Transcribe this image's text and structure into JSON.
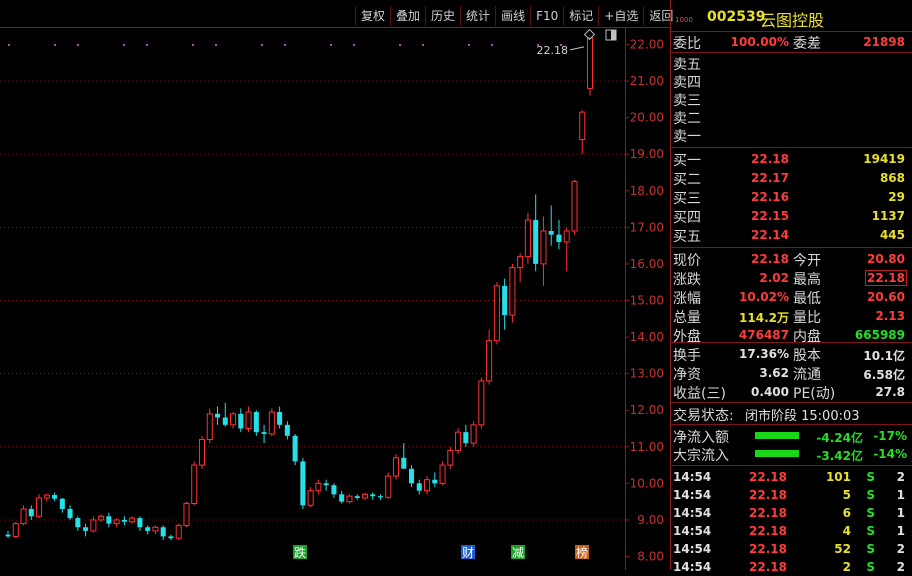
{
  "toolbar": [
    "复权",
    "叠加",
    "历史",
    "统计",
    "画线",
    "F10",
    "标记",
    "+自选",
    "返回"
  ],
  "stock": {
    "code_small": "1000",
    "code": "002539",
    "name": "云图控股"
  },
  "ratio": {
    "label": "委比",
    "value": "100.00%",
    "diff_label": "委差",
    "diff": "21898"
  },
  "sells": [
    {
      "label": "卖五",
      "price": "",
      "vol": ""
    },
    {
      "label": "卖四",
      "price": "",
      "vol": ""
    },
    {
      "label": "卖三",
      "price": "",
      "vol": ""
    },
    {
      "label": "卖二",
      "price": "",
      "vol": ""
    },
    {
      "label": "卖一",
      "price": "",
      "vol": ""
    }
  ],
  "buys": [
    {
      "label": "买一",
      "price": "22.18",
      "vol": "19419"
    },
    {
      "label": "买二",
      "price": "22.17",
      "vol": "868"
    },
    {
      "label": "买三",
      "price": "22.16",
      "vol": "29"
    },
    {
      "label": "买四",
      "price": "22.15",
      "vol": "1137"
    },
    {
      "label": "买五",
      "price": "22.14",
      "vol": "445"
    }
  ],
  "quote": [
    {
      "l1": "现价",
      "v1": "22.18",
      "c1": "red",
      "l2": "今开",
      "v2": "20.80",
      "c2": "red"
    },
    {
      "l1": "涨跌",
      "v1": "2.02",
      "c1": "red",
      "l2": "最高",
      "v2": "22.18",
      "c2": "red"
    },
    {
      "l1": "涨幅",
      "v1": "10.02%",
      "c1": "red",
      "l2": "最低",
      "v2": "20.60",
      "c2": "red"
    },
    {
      "l1": "总量",
      "v1": "114.2万",
      "c1": "yel",
      "l2": "量比",
      "v2": "2.13",
      "c2": "red"
    },
    {
      "l1": "外盘",
      "v1": "476487",
      "c1": "red",
      "l2": "内盘",
      "v2": "665989",
      "c2": "grn"
    }
  ],
  "fund": [
    {
      "l1": "换手",
      "v1": "17.36%",
      "l2": "股本",
      "v2": "10.1亿"
    },
    {
      "l1": "净资",
      "v1": "3.62",
      "l2": "流通",
      "v2": "6.58亿"
    },
    {
      "l1": "收益(三)",
      "v1": "0.400",
      "l2": "PE(动)",
      "v2": "27.8"
    }
  ],
  "status": {
    "label": "交易状态:",
    "value": "闭市阶段 15:00:03"
  },
  "flows": [
    {
      "label": "净流入额",
      "value": "-4.24亿",
      "pct": "-17%"
    },
    {
      "label": "大宗流入",
      "value": "-3.42亿",
      "pct": "-14%"
    }
  ],
  "ticks": [
    {
      "time": "14:54",
      "price": "22.18",
      "vol": "101",
      "bs": "S",
      "n": "2"
    },
    {
      "time": "14:54",
      "price": "22.18",
      "vol": "5",
      "bs": "S",
      "n": "1"
    },
    {
      "time": "14:54",
      "price": "22.18",
      "vol": "6",
      "bs": "S",
      "n": "1"
    },
    {
      "time": "14:54",
      "price": "22.18",
      "vol": "4",
      "bs": "S",
      "n": "1"
    },
    {
      "time": "14:54",
      "price": "22.18",
      "vol": "52",
      "bs": "S",
      "n": "2"
    },
    {
      "time": "14:54",
      "price": "22.18",
      "vol": "2",
      "bs": "S",
      "n": "2"
    }
  ],
  "chart_data": {
    "type": "candlestick",
    "price_label": "22.18",
    "y_ticks": [
      "22.00",
      "21.00",
      "20.00",
      "19.00",
      "18.00",
      "17.00",
      "16.00",
      "15.00",
      "14.00",
      "13.00",
      "12.00",
      "11.00",
      "10.00",
      "9.00",
      "8.00"
    ],
    "ylim": [
      7.85,
      22.45
    ],
    "markers": [
      "跌",
      "财",
      "减",
      "榜"
    ],
    "candles": [
      [
        8.6,
        8.7,
        8.5,
        8.55
      ],
      [
        8.55,
        8.95,
        8.5,
        8.9
      ],
      [
        8.9,
        9.4,
        8.85,
        9.3
      ],
      [
        9.3,
        9.4,
        9.0,
        9.1
      ],
      [
        9.1,
        9.7,
        9.05,
        9.6
      ],
      [
        9.6,
        9.72,
        9.5,
        9.68
      ],
      [
        9.68,
        9.75,
        9.52,
        9.58
      ],
      [
        9.58,
        9.6,
        9.2,
        9.3
      ],
      [
        9.3,
        9.4,
        9.0,
        9.05
      ],
      [
        9.05,
        9.1,
        8.7,
        8.8
      ],
      [
        8.8,
        8.9,
        8.55,
        8.7
      ],
      [
        8.7,
        9.1,
        8.65,
        9.0
      ],
      [
        9.0,
        9.15,
        8.95,
        9.1
      ],
      [
        9.1,
        9.2,
        8.8,
        8.9
      ],
      [
        8.9,
        9.05,
        8.8,
        9.0
      ],
      [
        9.0,
        9.1,
        8.85,
        8.95
      ],
      [
        8.95,
        9.1,
        8.9,
        9.05
      ],
      [
        9.05,
        9.1,
        8.7,
        8.8
      ],
      [
        8.8,
        8.85,
        8.6,
        8.7
      ],
      [
        8.7,
        8.85,
        8.6,
        8.8
      ],
      [
        8.8,
        8.85,
        8.45,
        8.55
      ],
      [
        8.55,
        8.6,
        8.45,
        8.5
      ],
      [
        8.5,
        8.9,
        8.45,
        8.85
      ],
      [
        8.85,
        9.5,
        8.8,
        9.45
      ],
      [
        9.45,
        10.6,
        9.4,
        10.5
      ],
      [
        10.5,
        11.3,
        10.4,
        11.2
      ],
      [
        11.2,
        12.05,
        11.1,
        11.9
      ],
      [
        11.9,
        12.1,
        11.6,
        11.8
      ],
      [
        11.8,
        12.2,
        11.55,
        11.6
      ],
      [
        11.6,
        11.95,
        11.5,
        11.9
      ],
      [
        11.9,
        12.05,
        11.4,
        11.5
      ],
      [
        11.5,
        12.1,
        11.4,
        11.95
      ],
      [
        11.95,
        12.0,
        11.3,
        11.4
      ],
      [
        11.4,
        11.6,
        11.1,
        11.35
      ],
      [
        11.35,
        12.05,
        11.3,
        11.95
      ],
      [
        11.95,
        12.1,
        11.5,
        11.6
      ],
      [
        11.6,
        11.7,
        11.2,
        11.3
      ],
      [
        11.3,
        11.35,
        10.5,
        10.6
      ],
      [
        10.6,
        10.7,
        9.3,
        9.4
      ],
      [
        9.4,
        9.9,
        9.35,
        9.8
      ],
      [
        9.8,
        10.1,
        9.7,
        10.0
      ],
      [
        10.0,
        10.1,
        9.8,
        9.95
      ],
      [
        9.95,
        10.0,
        9.6,
        9.7
      ],
      [
        9.7,
        9.8,
        9.45,
        9.5
      ],
      [
        9.5,
        9.7,
        9.45,
        9.65
      ],
      [
        9.65,
        9.7,
        9.55,
        9.6
      ],
      [
        9.6,
        9.75,
        9.55,
        9.7
      ],
      [
        9.7,
        9.75,
        9.55,
        9.65
      ],
      [
        9.65,
        9.7,
        9.55,
        9.62
      ],
      [
        9.62,
        10.3,
        9.58,
        10.2
      ],
      [
        10.2,
        10.8,
        10.1,
        10.7
      ],
      [
        10.7,
        11.1,
        10.6,
        10.4
      ],
      [
        10.4,
        10.5,
        9.9,
        10.0
      ],
      [
        10.0,
        10.1,
        9.7,
        9.8
      ],
      [
        9.8,
        10.2,
        9.7,
        10.1
      ],
      [
        10.1,
        10.3,
        9.9,
        10.0
      ],
      [
        10.0,
        10.6,
        9.95,
        10.5
      ],
      [
        10.5,
        11.0,
        10.4,
        10.9
      ],
      [
        10.9,
        11.5,
        10.8,
        11.4
      ],
      [
        11.4,
        11.6,
        11.0,
        11.1
      ],
      [
        11.1,
        11.7,
        11.0,
        11.6
      ],
      [
        11.6,
        12.9,
        11.5,
        12.8
      ],
      [
        12.8,
        14.2,
        12.7,
        13.9
      ],
      [
        13.9,
        15.5,
        13.8,
        15.4
      ],
      [
        15.4,
        15.6,
        14.2,
        14.6
      ],
      [
        14.6,
        16.0,
        14.4,
        15.9
      ],
      [
        15.9,
        16.3,
        15.5,
        16.2
      ],
      [
        16.2,
        17.4,
        16.0,
        17.2
      ],
      [
        17.2,
        17.9,
        15.8,
        16.0
      ],
      [
        16.0,
        17.3,
        15.4,
        16.9
      ],
      [
        16.9,
        17.6,
        16.5,
        16.8
      ],
      [
        16.8,
        17.2,
        16.4,
        16.6
      ],
      [
        16.6,
        17.0,
        15.8,
        16.9
      ],
      [
        16.9,
        18.3,
        16.8,
        18.25
      ],
      [
        19.4,
        20.2,
        19.0,
        20.15
      ],
      [
        20.8,
        22.18,
        20.6,
        22.18
      ]
    ]
  }
}
